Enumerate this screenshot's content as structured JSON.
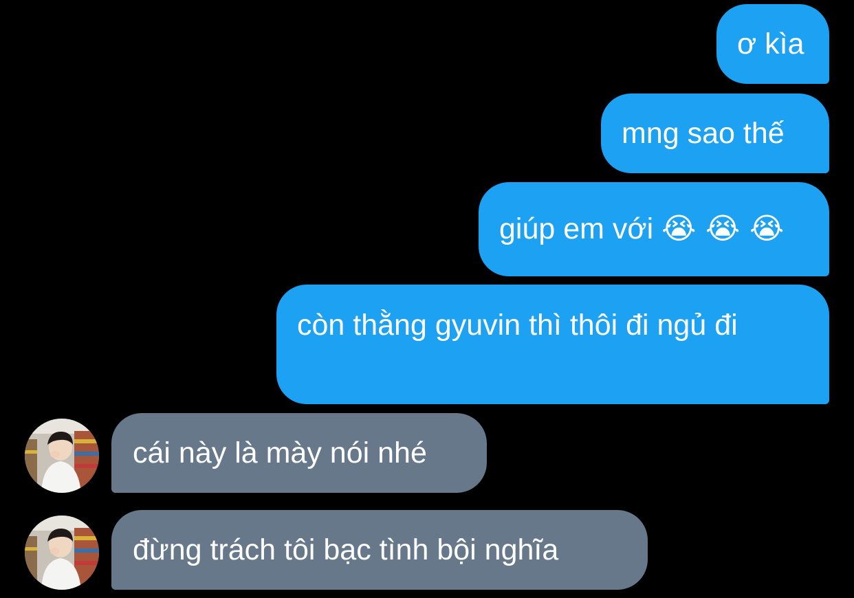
{
  "conversation": {
    "messages": [
      {
        "direction": "outgoing",
        "text": "ơ kìa"
      },
      {
        "direction": "outgoing",
        "text": "mng sao thế"
      },
      {
        "direction": "outgoing",
        "text": "giúp em với",
        "emoji": "😭 😭 😭"
      },
      {
        "direction": "outgoing",
        "text": "còn thằng gyuvin thì thôi đi ngủ đi"
      },
      {
        "direction": "incoming",
        "text": "cái này là mày nói nhé"
      },
      {
        "direction": "incoming",
        "text": "đừng trách tôi bạc tình bội nghĩa"
      }
    ]
  },
  "colors": {
    "background": "#000000",
    "outgoing_bubble": "#1da1f2",
    "incoming_bubble": "#66788a",
    "text": "#ffffff"
  },
  "icons": {
    "avatar": "user-avatar-photo",
    "emoji": "loudly-crying-face"
  }
}
